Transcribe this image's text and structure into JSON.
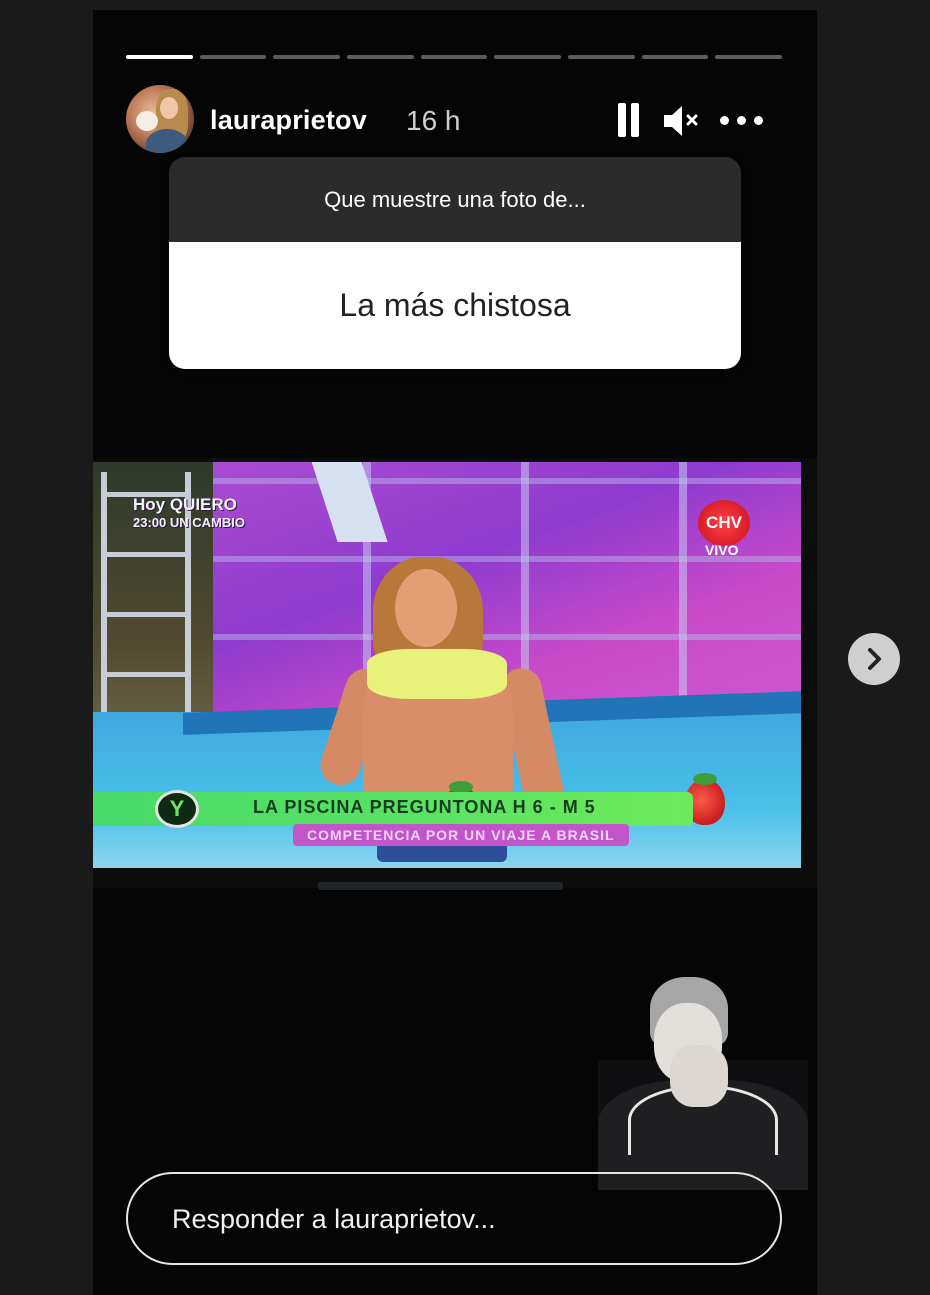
{
  "story": {
    "progress": {
      "total_segments": 9,
      "current_segment": 1
    },
    "user": {
      "username": "lauraprietov",
      "time_ago": "16 h"
    },
    "controls": {
      "pause_icon": "pause-icon",
      "mute_icon": "mute-icon",
      "more_icon": "more-icon"
    },
    "question_sticker": {
      "prompt": "Que muestre una foto de...",
      "answer": "La más chistosa"
    },
    "tv_photo": {
      "logo_left_line1": "Hoy QUIERO",
      "logo_left_line2": "23:00 UN CAMBIO",
      "channel_logo": "CHV",
      "channel_status": "VIVO",
      "ticker_title": "LA PISCINA PREGUNTONA  H 6 - M 5",
      "ticker_subtitle": "COMPETENCIA POR UN VIAJE A BRASIL",
      "ticker_logo": "Y"
    },
    "reply": {
      "placeholder": "Responder a lauraprietov..."
    },
    "next_icon": "chevron-right-icon"
  },
  "colors": {
    "background": "#050505",
    "outer": "#1a1a1a",
    "question_header": "#2b2b2b",
    "answer_bg": "#ffffff",
    "ticker_green": "#47d96a"
  }
}
